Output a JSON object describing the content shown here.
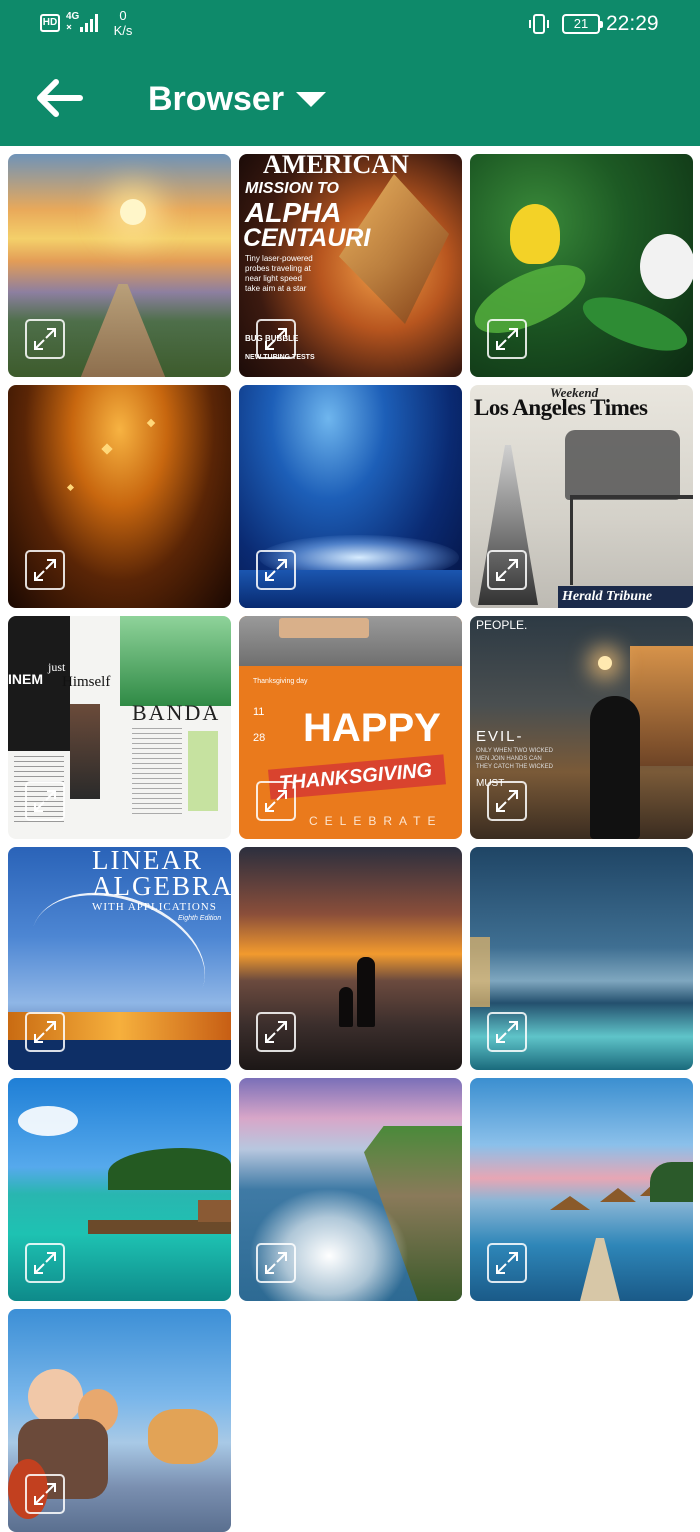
{
  "status_bar": {
    "network_badge": "HD",
    "network_type": "4G",
    "data_speed_value": "0",
    "data_speed_unit": "K/s",
    "battery_level": "21",
    "time": "22:29"
  },
  "app_bar": {
    "back_icon": "arrow-left-icon",
    "title": "Browser",
    "dropdown_icon": "caret-down-icon"
  },
  "colors": {
    "primary": "#0e8a6a",
    "background": "#ffffff"
  },
  "gallery": {
    "expand_icon": "expand-icon",
    "tiles": [
      {
        "subject": "mountain path at sunset",
        "text": []
      },
      {
        "subject": "magazine cover",
        "text": [
          "AMERICAN",
          "MISSION TO",
          "ALPHA",
          "CENTAURI",
          "Tiny laser-powered",
          "probes traveling at",
          "near light speed",
          "take aim at a star",
          "BUG BUBBLE",
          "NEW TURING TESTS"
        ]
      },
      {
        "subject": "tropical leaves and flowers",
        "text": []
      },
      {
        "subject": "golden sparkling stars",
        "text": []
      },
      {
        "subject": "water splash on blue",
        "text": []
      },
      {
        "subject": "newspaper collage",
        "text": [
          "Weekend",
          "Los Angeles Times",
          "Herald Tribune"
        ]
      },
      {
        "subject": "magazine layout",
        "text": [
          "INEM",
          "just",
          "Himself",
          "BANDA"
        ]
      },
      {
        "subject": "thanksgiving card",
        "text": [
          "Thanksgiving day",
          "11",
          "28",
          "HAPPY",
          "THANKSGIVING",
          "CELEBRATE"
        ]
      },
      {
        "subject": "hooded figure in city",
        "text": [
          "PEOPLE.",
          "EVIL-",
          "ONLY WHEN TWO WICKED",
          "MEN JOIN HANDS CAN",
          "THEY CATCH THE WICKED",
          "MUST"
        ]
      },
      {
        "subject": "book cover bridge",
        "text": [
          "LINEAR",
          "ALGEBRA",
          "WITH APPLICATIONS",
          "Eighth Edition"
        ]
      },
      {
        "subject": "beach sunset silhouettes",
        "text": []
      },
      {
        "subject": "infinity pool dusk",
        "text": []
      },
      {
        "subject": "tropical jetty",
        "text": []
      },
      {
        "subject": "coastal cliff waves",
        "text": []
      },
      {
        "subject": "resort pool",
        "text": []
      },
      {
        "subject": "animated characters",
        "text": []
      }
    ]
  }
}
